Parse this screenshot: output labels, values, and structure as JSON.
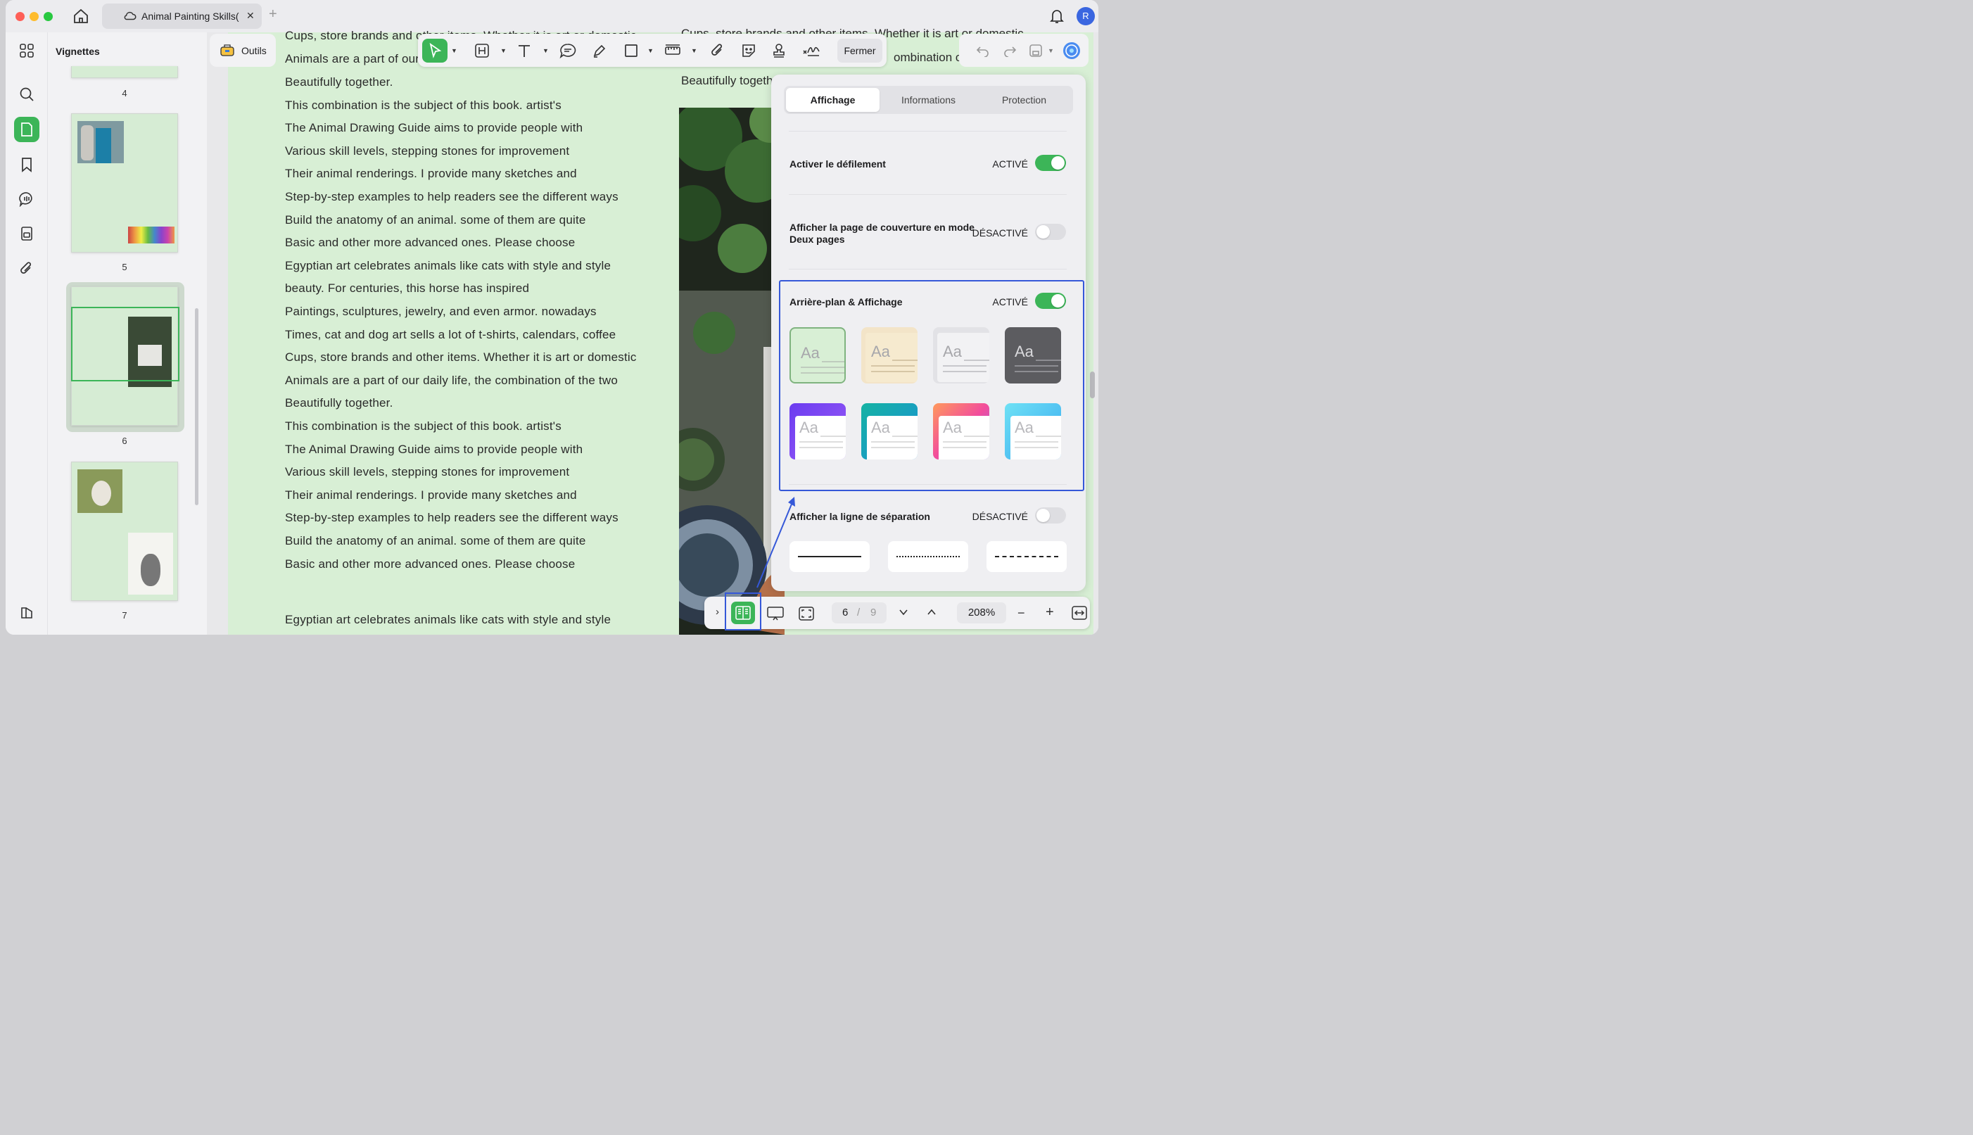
{
  "window": {
    "tab_title": "Animal Painting Skills(",
    "avatar_initial": "R"
  },
  "sidebar": {
    "title": "Vignettes",
    "pages": [
      "4",
      "5",
      "6",
      "7"
    ]
  },
  "toolbar": {
    "tools_label": "Outils",
    "close_label": "Fermer"
  },
  "document": {
    "overflow_lines": [
      "Cups, store brands and other items. Whether it is art or domestic",
      "Animals are a part of our"
    ],
    "lines": [
      "Beautifully together.",
      "This combination is the subject of this book. artist's",
      "The Animal Drawing Guide aims to provide people with",
      "Various skill levels, stepping stones for improvement",
      "Their animal renderings. I provide many sketches and",
      "Step-by-step examples to help readers see the different ways",
      "Build the anatomy of an animal. some of them are quite",
      "Basic and other more advanced ones. Please choose",
      "Egyptian art celebrates animals like cats with style and style",
      "beauty. For centuries, this horse has inspired",
      "Paintings, sculptures, jewelry, and even armor. nowadays",
      "Times, cat and dog art sells a lot of t-shirts, calendars, coffee",
      "Cups, store brands and other items. Whether it is art or domestic",
      "Animals are a part of our daily life, the combination of the two",
      "Beautifully together.",
      "This combination is the subject of this book. artist's",
      "The Animal Drawing Guide aims to provide people with",
      "Various skill levels, stepping stones for improvement",
      "Their animal renderings. I provide many sketches and",
      "Step-by-step examples to help readers see the different ways",
      "Build the anatomy of an animal. some of them are quite",
      "Basic and other more advanced ones. Please choose"
    ],
    "last_line": "Egyptian art celebrates animals like cats with style and style",
    "right_top": "Cups, store brands and other items. Whether it is art or domestic",
    "right_mid": "ombination of",
    "right_line": "Beautifully togeth"
  },
  "panel": {
    "tabs": [
      "Affichage",
      "Informations",
      "Protection"
    ],
    "scroll": {
      "label": "Activer le défilement",
      "state": "ACTIVÉ",
      "on": true
    },
    "cover": {
      "label_line1": "Afficher la page de couverture en mode",
      "label_line2": "Deux pages",
      "state": "DÉSACTIVÉ",
      "on": false
    },
    "background": {
      "label": "Arrière-plan & Affichage",
      "state": "ACTIVÉ",
      "on": true,
      "theme_text": "Aa"
    },
    "separator": {
      "label": "Afficher la ligne de séparation",
      "state": "DÉSACTIVÉ",
      "on": false
    }
  },
  "bottom": {
    "current_page": "6",
    "separator": "/",
    "total_pages": "9",
    "zoom": "208%"
  },
  "colors": {
    "accent": "#3cb558",
    "highlight": "#3558d8",
    "page_bg": "#d8efd5"
  }
}
